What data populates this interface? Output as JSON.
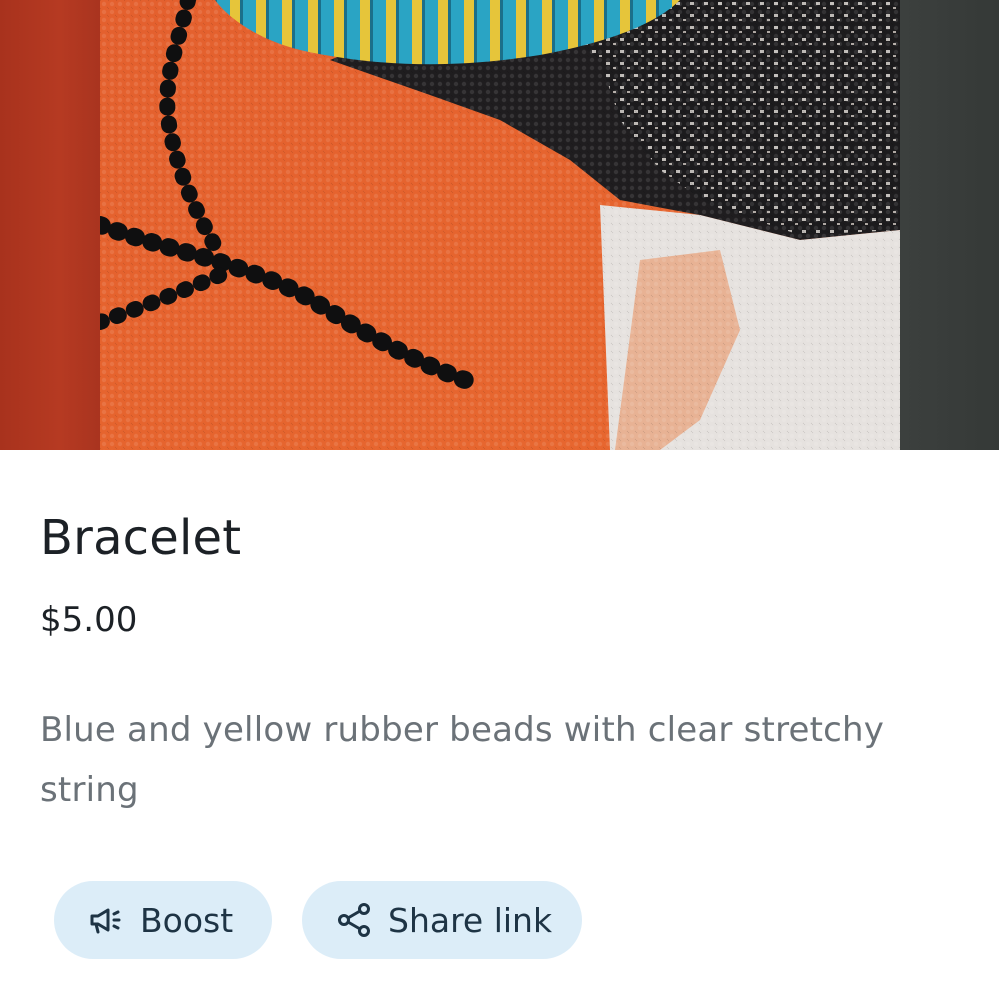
{
  "product": {
    "title": "Bracelet",
    "price": "$5.00",
    "description": "Blue and yellow rubber beads with clear stretchy string"
  },
  "actions": {
    "boost": {
      "label": "Boost",
      "icon": "megaphone-icon"
    },
    "share": {
      "label": "Share link",
      "icon": "share-icon"
    }
  },
  "colors": {
    "chip_bg": "#dcedf8",
    "chip_text": "#1e3445",
    "title_text": "#1c2126",
    "description_text": "#6b7278"
  }
}
